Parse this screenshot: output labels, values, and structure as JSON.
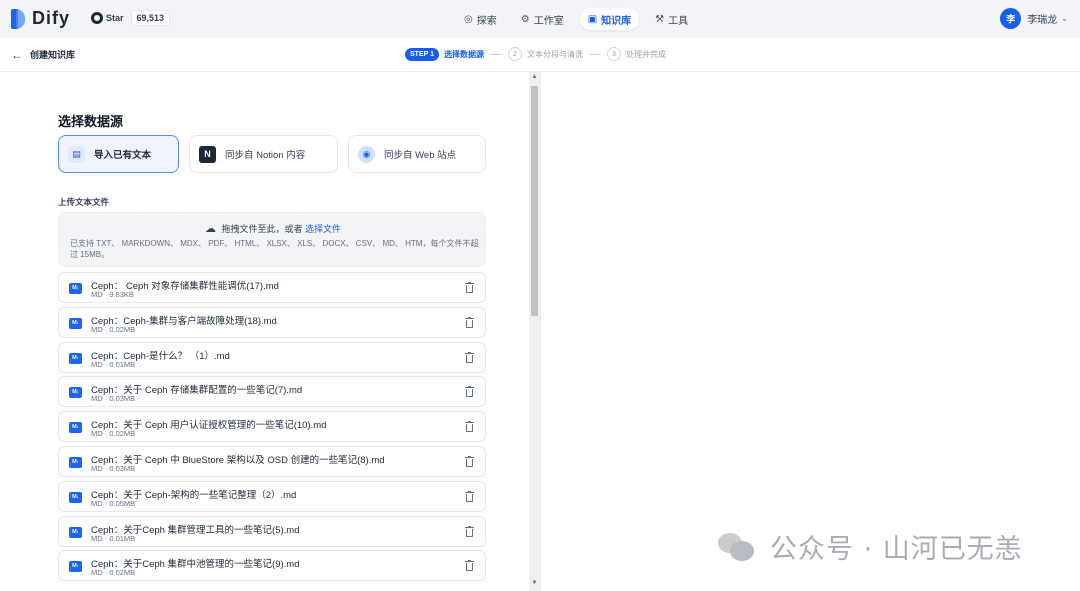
{
  "app": {
    "logo_text": "Dify"
  },
  "github": {
    "star_label": "Star",
    "star_count": "69,513"
  },
  "nav": {
    "items": [
      {
        "label": "探索",
        "icon": "explore-icon"
      },
      {
        "label": "工作室",
        "icon": "studio-icon"
      },
      {
        "label": "知识库",
        "icon": "knowledge-icon",
        "active": true
      },
      {
        "label": "工具",
        "icon": "tools-icon"
      }
    ]
  },
  "user": {
    "avatar_initial": "李",
    "name": "李瑞龙"
  },
  "stepbar": {
    "back_title": "创建知识库",
    "step1_pill": "STEP 1",
    "step1_label": "选择数据源",
    "step2_num": "2",
    "step2_label": "文本分段与清洗",
    "step3_num": "3",
    "step3_label": "处理并完成"
  },
  "datasource": {
    "title": "选择数据源",
    "options": [
      {
        "label": "导入已有文本",
        "icon": "file-icon"
      },
      {
        "label": "同步自 Notion 内容",
        "icon": "notion-icon"
      },
      {
        "label": "同步自 Web 站点",
        "icon": "web-icon"
      }
    ]
  },
  "upload": {
    "label": "上传文本文件",
    "drop_text": "拖拽文件至此，或者",
    "select_link": "选择文件",
    "supported": "已支持 TXT、 MARKDOWN、 MDX、 PDF、 HTML、 XLSX、 XLS、 DOCX、 CSV、 MD、 HTM，每个文件不超过 15MB。"
  },
  "files": [
    {
      "name": "Ceph：  Ceph 对象存储集群性能调优(17).md",
      "meta": "MD · 9.83KB"
    },
    {
      "name": "Ceph：Ceph-集群与客户端故障处理(18).md",
      "meta": "MD · 0.02MB"
    },
    {
      "name": "Ceph：Ceph-是什么？ （1）.md",
      "meta": "MD · 0.01MB"
    },
    {
      "name": "Ceph：关于 Ceph 存储集群配置的一些笔记(7).md",
      "meta": "MD · 0.03MB"
    },
    {
      "name": "Ceph：关于 Ceph 用户认证授权管理的一些笔记(10).md",
      "meta": "MD · 0.02MB"
    },
    {
      "name": "Ceph：关于 Ceph 中 BlueStore 架构以及 OSD 创建的一些笔记(8).md",
      "meta": "MD · 0.03MB"
    },
    {
      "name": "Ceph：关于 Ceph-架构的一些笔记整理（2）.md",
      "meta": "MD · 0.05MB"
    },
    {
      "name": "Ceph：关于Ceph 集群管理工具的一些笔记(5).md",
      "meta": "MD · 0.01MB"
    },
    {
      "name": "Ceph：关于Ceph 集群中池管理的一些笔记(9).md",
      "meta": "MD · 0.02MB"
    }
  ],
  "watermark": {
    "text": "公众号 · 山河已无恙"
  },
  "colors": {
    "accent": "#155eef",
    "md_icon": "#1c64f2",
    "topbar_bg": "#f2f4f7"
  }
}
